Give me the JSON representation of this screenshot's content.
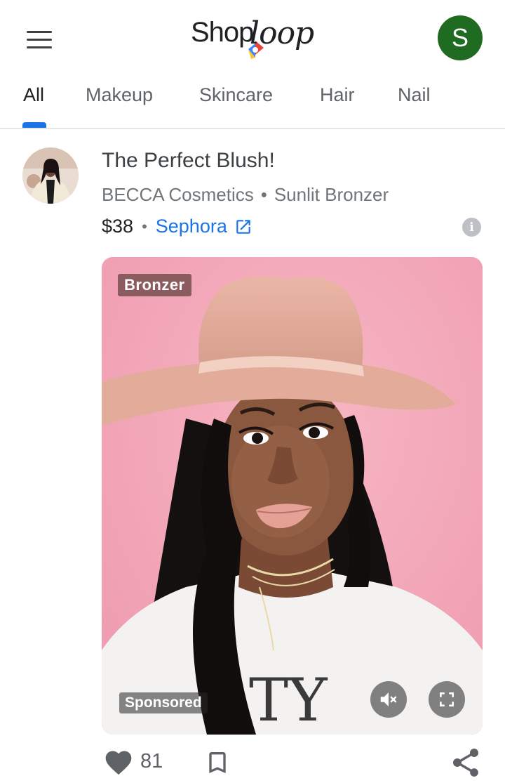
{
  "app": {
    "logo_text_1": "Shop",
    "logo_text_2": "loop",
    "user_initial": "S",
    "avatar_color": "#1e6b21",
    "accent": "#1a73e8"
  },
  "tabs": [
    {
      "label": "All",
      "active": true
    },
    {
      "label": "Makeup"
    },
    {
      "label": "Skincare"
    },
    {
      "label": "Hair"
    },
    {
      "label": "Nail"
    }
  ],
  "post": {
    "title": "The Perfect Blush!",
    "brand": "BECCA Cosmetics",
    "product": "Sunlit Bronzer",
    "separator": "•",
    "price": "$38",
    "store": "Sephora",
    "info_icon": "i"
  },
  "video": {
    "tag": "Bronzer",
    "sponsored": "Sponsored",
    "shirt_text": "TY",
    "muted": true
  },
  "actions": {
    "likes": "81"
  },
  "icons": [
    "menu-icon",
    "shoploop-logo",
    "external-link-icon",
    "info-icon",
    "mute-icon",
    "fullscreen-icon",
    "heart-icon",
    "bookmark-icon",
    "share-icon"
  ]
}
